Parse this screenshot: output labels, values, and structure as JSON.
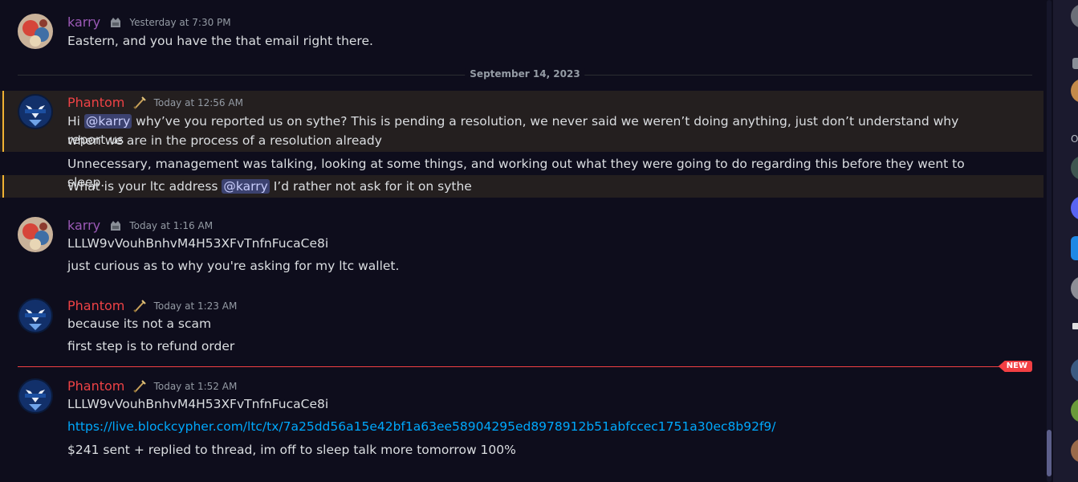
{
  "date_divider": "September 14, 2023",
  "new_label": "NEW",
  "groups": [
    {
      "username": "karry",
      "timestamp": "Yesterday at 7:30 PM",
      "lines": [
        "Eastern, and you have the that email right there."
      ]
    },
    {
      "username": "Phantom",
      "timestamp": "Today at 12:56 AM",
      "msg1": {
        "prefix": "Hi ",
        "mention": "@karry",
        "text1": " why’ve you reported us on sythe? This is pending a resolution, we never said we weren’t doing anything, just don’t understand why report us",
        "text2": "when we are in the process of a resolution already"
      },
      "msg2": "Unnecessary, management was talking, looking at some things, and working out what they were going to do regarding this before they went to sleep.",
      "msg3": {
        "prefix": "What is your ltc address ",
        "mention": "@karry",
        "suffix": " I’d rather not ask for it on sythe"
      }
    },
    {
      "username": "karry",
      "timestamp": "Today at 1:16 AM",
      "lines": [
        "LLLW9vVouhBnhvM4H53XFvTnfnFucaCe8i",
        "just curious as to why you're asking for my ltc wallet."
      ]
    },
    {
      "username": "Phantom",
      "timestamp": "Today at 1:23 AM",
      "lines": [
        "because its not a scam",
        "first step is to refund order"
      ]
    },
    {
      "username": "Phantom",
      "timestamp": "Today at 1:52 AM",
      "line1": "LLLW9vVouhBnhvM4H53XFvTnfnFucaCe8i",
      "link": "https://live.blockcypher.com/ltc/tx/7a25dd56a15e42bf1a63ee58904295ed8978912b51abfccec1751a30ec8b92f9/",
      "line3": "$241 sent + replied to thread, im off to sleep talk more tomorrow 100%"
    }
  ],
  "member_list_fragment": "O",
  "colors": {
    "background": "#0e0d1c",
    "karry_name": "#9b59b6",
    "phantom_name": "#ed4245",
    "mention_bg": "#3c4270",
    "link": "#00a8fc",
    "new_divider": "#f23f43",
    "highlight_bar": "#f0b232"
  }
}
